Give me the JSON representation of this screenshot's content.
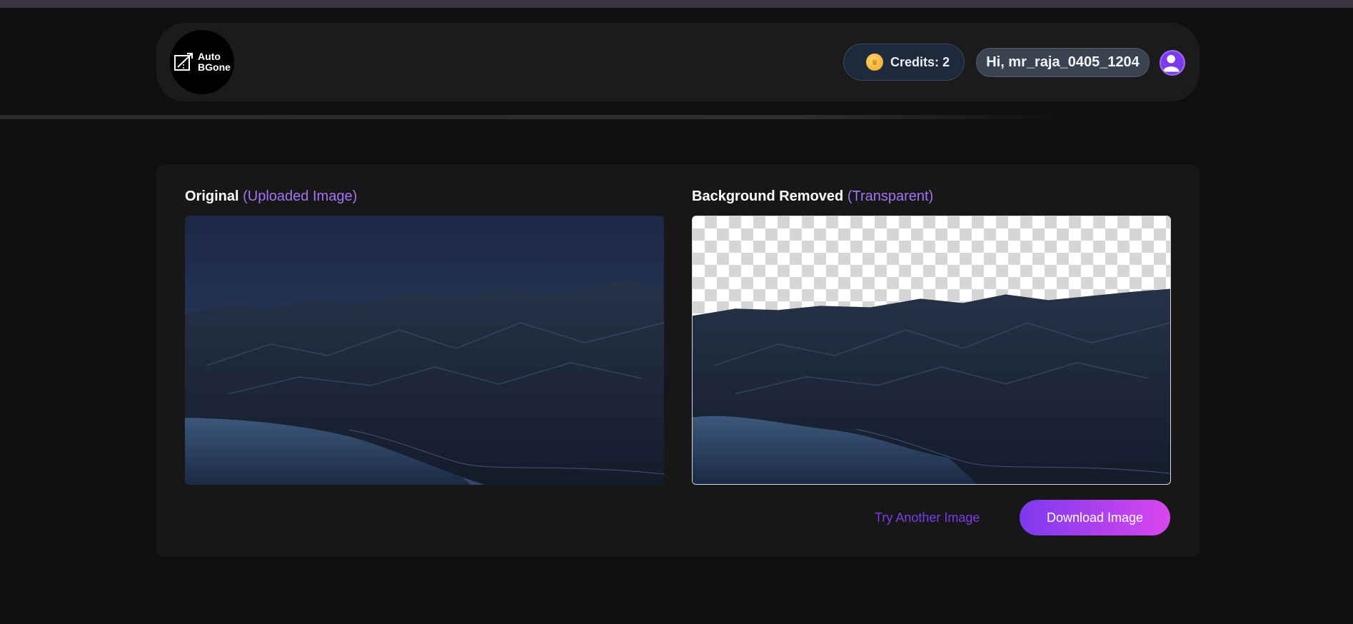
{
  "app": {
    "logo_line1": "Auto",
    "logo_line2": "BGone"
  },
  "header": {
    "credits_label": "Credits: 2",
    "greeting": "Hi, mr_raja_0405_1204",
    "avatar_icon": "user-avatar-icon",
    "coin_icon": "coin-icon"
  },
  "result": {
    "original_title": "Original",
    "original_sub": "(Uploaded Image)",
    "removed_title": "Background Removed",
    "removed_sub": "(Transparent)",
    "try_another": "Try Another Image",
    "download": "Download Image"
  },
  "colors": {
    "accent": "#7c3aed",
    "accent_end": "#d946ef",
    "card_bg": "#171717",
    "page_bg": "#0f0f0f"
  }
}
